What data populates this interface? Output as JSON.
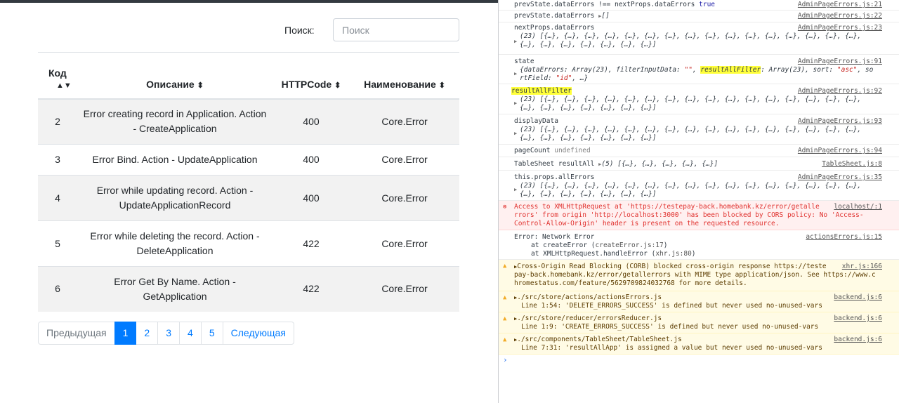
{
  "search": {
    "label": "Поиск:",
    "placeholder": "Поиск"
  },
  "table": {
    "headers": [
      "Код",
      "Описание",
      "HTTPCode",
      "Наименование"
    ],
    "rows": [
      {
        "code": "2",
        "desc": "Error creating record in Application. Action - CreateApplication",
        "http": "400",
        "name": "Core.Error"
      },
      {
        "code": "3",
        "desc": "Error Bind. Action - UpdateApplication",
        "http": "400",
        "name": "Core.Error"
      },
      {
        "code": "4",
        "desc": "Error while updating record. Action - UpdateApplicationRecord",
        "http": "400",
        "name": "Core.Error"
      },
      {
        "code": "5",
        "desc": "Error while deleting the record. Action - DeleteApplication",
        "http": "422",
        "name": "Core.Error"
      },
      {
        "code": "6",
        "desc": "Error Get By Name. Action - GetApplication",
        "http": "422",
        "name": "Core.Error"
      }
    ]
  },
  "pagination": {
    "prev": "Предыдущая",
    "pages": [
      "1",
      "2",
      "3",
      "4",
      "5"
    ],
    "active": "1",
    "next": "Следующая"
  },
  "console": {
    "m1": {
      "text": "prevState.dataErrors !== nextProps.dataErrors",
      "val": "true",
      "src": "AdminPageErrors.js:21"
    },
    "m2": {
      "text": "prevState.dataErrors",
      "val": "[]",
      "src": "AdminPageErrors.js:22"
    },
    "m3": {
      "text": "nextProps.dataErrors",
      "l1": "(23) [{…}, {…}, {…}, {…}, {…}, {…}, {…}, {…}, {…}, {…}, {…}, {…}, {…}, {…}, {…}, {…},",
      "l2": "{…}, {…}, {…}, {…}, {…}, {…}, {…}]",
      "src": "AdminPageErrors.js:23"
    },
    "m4": {
      "text": "state",
      "a": "{dataErrors: Array(23), filterInputData: ",
      "b": "\"\"",
      "c": ", ",
      "d": "resultAllFilter",
      "e": ": Array(23), sort: ",
      "f": "\"asc\"",
      "g": ", so",
      "h": "rtField: ",
      "i": "\"id\"",
      "j": ", …}",
      "src": "AdminPageErrors.js:91"
    },
    "m5": {
      "text": "resultAllFilter",
      "l1": "(23) [{…}, {…}, {…}, {…}, {…}, {…}, {…}, {…}, {…}, {…}, {…}, {…}, {…}, {…}, {…}, {…},",
      "l2": "{…}, {…}, {…}, {…}, {…}, {…}, {…}]",
      "src": "AdminPageErrors.js:92"
    },
    "m6": {
      "text": "displayData",
      "l1": "(23) [{…}, {…}, {…}, {…}, {…}, {…}, {…}, {…}, {…}, {…}, {…}, {…}, {…}, {…}, {…}, {…},",
      "l2": "{…}, {…}, {…}, {…}, {…}, {…}, {…}]",
      "src": "AdminPageErrors.js:93"
    },
    "m7": {
      "text": "pageCount",
      "val": "undefined",
      "src": "AdminPageErrors.js:94"
    },
    "m8": {
      "text": "TableSheet resultAll",
      "val": "(5) [{…}, {…}, {…}, {…}, {…}]",
      "src": "TableSheet.js:8"
    },
    "m9": {
      "text": "this.props.allErrors",
      "l1": "(23) [{…}, {…}, {…}, {…}, {…}, {…}, {…}, {…}, {…}, {…}, {…}, {…}, {…}, {…}, {…}, {…},",
      "l2": "{…}, {…}, {…}, {…}, {…}, {…}, {…}]",
      "src": "AdminPageErrors.js:35"
    },
    "err": {
      "a": "Access to XMLHttpRequest at '",
      "url1": "https://testepay-back.homebank.kz/error/getalle",
      "url2": "rrors",
      "b": "' from origin '",
      "origin": "http://localhost:3000",
      "c": "' has been blocked by CORS policy: No 'Access-",
      "d": "Control-Allow-Origin' header is present on the requested resource.",
      "src": "localhost/:1"
    },
    "net": {
      "l1": "Error: Network Error",
      "l2a": "at createError (",
      "l2b": "createError.js:17",
      "l2c": ")",
      "l3a": "at XMLHttpRequest.handleError (",
      "l3b": "xhr.js:80",
      "l3c": ")",
      "src": "actionsErrors.js:15"
    },
    "corb": {
      "a": "Cross-Origin Read Blocking (CORB) blocked cross-origin response ",
      "u1": "https://teste",
      "u2": "pay-back.homebank.kz/error/getallerrors",
      "b": " with MIME type application/json. See ",
      "u3": "https://www.c",
      "u4": "hromestatus.com/feature/5629709824032768",
      "c": " for more details.",
      "src": "xhr.js:166"
    },
    "w1": {
      "file": "./src/store/actions/actionsErrors.js",
      "line": "Line 1:54:  'DELETE_ERRORS_SUCCESS' is defined but never used  no-unused-vars",
      "src": "backend.js:6"
    },
    "w2": {
      "file": "./src/store/reducer/errorsReducer.js",
      "line": "Line 1:9:  'CREATE_ERRORS_SUCCESS' is defined but never used  no-unused-vars",
      "src": "backend.js:6"
    },
    "w3": {
      "file": "./src/components/TableSheet/TableSheet.js",
      "line": "Line 7:31:  'resultAllApp' is assigned a value but never used  no-unused-vars",
      "src": "backend.js:6"
    },
    "prompt": "›"
  }
}
